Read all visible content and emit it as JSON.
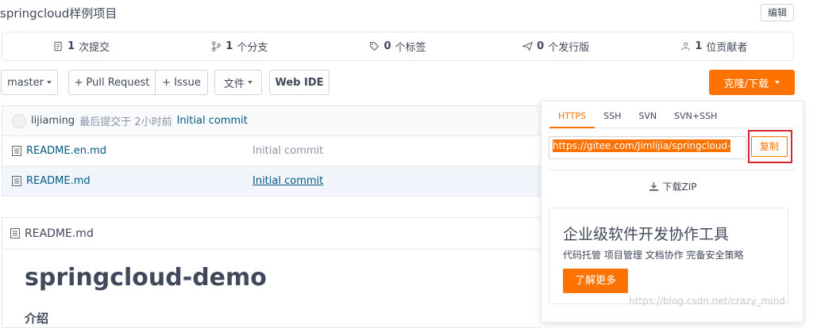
{
  "repo": {
    "title": "springcloud样例项目",
    "edit_label": "编辑"
  },
  "stats": [
    {
      "icon": "commit-icon",
      "count": "1",
      "label": "次提交"
    },
    {
      "icon": "branch-icon",
      "count": "1",
      "label": "个分支"
    },
    {
      "icon": "tag-icon",
      "count": "0",
      "label": "个标签"
    },
    {
      "icon": "release-icon",
      "count": "0",
      "label": "个发行版"
    },
    {
      "icon": "contributor-icon",
      "count": "1",
      "label": "位贡献者"
    }
  ],
  "toolbar": {
    "branch": "master",
    "pull_request": "+ Pull Request",
    "issue": "+ Issue",
    "files": "文件",
    "web_ide": "Web IDE",
    "clone": "克隆/下载"
  },
  "last_commit": {
    "author": "lijiaming",
    "meta": "最后提交于 2小时前",
    "message": "Initial commit"
  },
  "files": [
    {
      "name": "README.en.md",
      "commit": "Initial commit"
    },
    {
      "name": "README.md",
      "commit": "Initial commit"
    }
  ],
  "readme": {
    "filename": "README.md",
    "heading": "springcloud-demo",
    "subheading": "介绍"
  },
  "clone_popup": {
    "tabs": [
      "HTTPS",
      "SSH",
      "SVN",
      "SVN+SSH"
    ],
    "active_tab": "HTTPS",
    "url": "https://gitee.com/Jimlijia/springcloud-",
    "copy_label": "复制",
    "download_zip": "下载ZIP",
    "promo_title": "企业级软件开发协作工具",
    "promo_sub": "代码托管 项目管理 文档协作 完备安全策略",
    "promo_button": "了解更多"
  },
  "watermark": "https://blog.csdn.net/crazy_mind",
  "colors": {
    "accent": "#fe7300",
    "highlight_border": "#d9232e",
    "link": "#005980"
  }
}
